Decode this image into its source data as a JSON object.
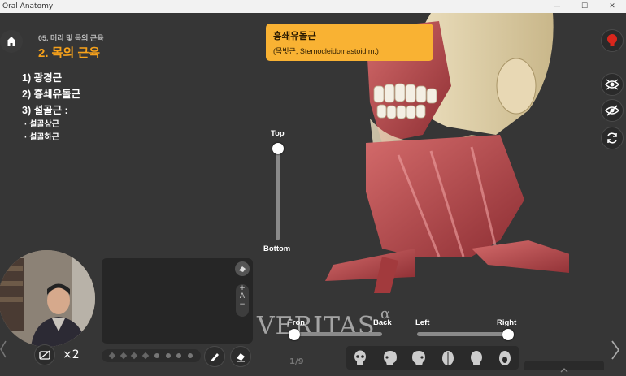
{
  "window": {
    "title": "Oral Anatomy",
    "controls": [
      "—",
      "☐",
      "✕"
    ]
  },
  "header": {
    "subtitle": "05. 머리 및 목의 근육",
    "chapter": "2. 목의 근육"
  },
  "outline": {
    "items": [
      "1) 광경근",
      "2) 흉쇄유돌근",
      "3) 설골근 :"
    ],
    "subitems": [
      "· 설골상근",
      "· 설골하근"
    ]
  },
  "tooltip": {
    "title": "흉쇄유돌근",
    "subtitle": "(목빗근, Sternocleidomastoid m.)"
  },
  "vertical_slider": {
    "top_label": "Top",
    "bottom_label": "Bottom",
    "value": 0.0
  },
  "front_back_slider": {
    "left_label": "Fron",
    "right_label": "Back",
    "value": 0.0
  },
  "left_right_slider": {
    "left_label": "Left",
    "right_label": "Right",
    "value": 1.0
  },
  "video": {
    "speed_label": "×2"
  },
  "zoom": {
    "level": "A"
  },
  "pager": {
    "text": "1/9"
  },
  "watermark": {
    "text": "VERITAS",
    "symbol": "α"
  },
  "colors": {
    "accent": "#f7a21b",
    "tooltip_bg": "#f9b233",
    "hint_red": "#d9261c",
    "background": "#363636"
  },
  "icons": {
    "home": "home-icon",
    "hint": "lightbulb-icon",
    "xray": "eye-scan-icon",
    "hide": "eye-off-icon",
    "reset": "rotate-icon",
    "camera": "camera-off-icon",
    "pen": "pen-icon",
    "eraser": "eraser-icon",
    "nav_left": "chevron-left-icon",
    "nav_right": "chevron-right-icon"
  }
}
